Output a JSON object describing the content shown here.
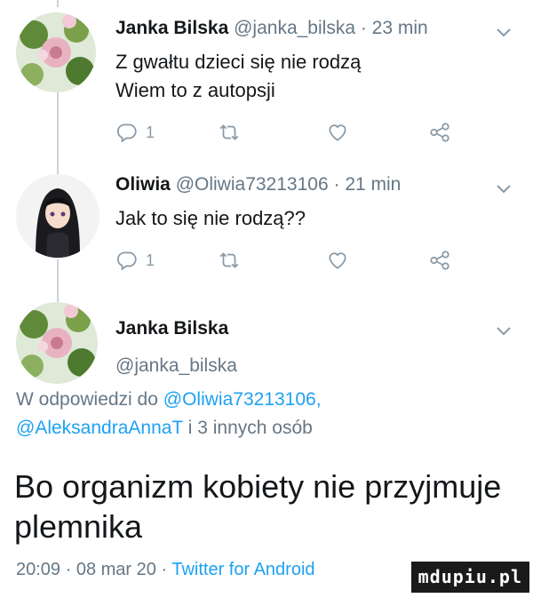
{
  "tweet1": {
    "name": "Janka Bilska",
    "handle": "@janka_bilska",
    "time": "23 min",
    "lines": [
      "Z gwałtu dzieci się nie rodzą",
      "Wiem to z autopsji"
    ],
    "reply_count": "1"
  },
  "tweet2": {
    "name": "Oliwia",
    "handle": "@Oliwia73213106",
    "time": "21 min",
    "lines": [
      "Jak to się nie rodzą??"
    ],
    "reply_count": "1"
  },
  "main": {
    "name": "Janka Bilska",
    "handle": "@janka_bilska",
    "reply_prefix": "W odpowiedzi do ",
    "reply_user1": "@Oliwia73213106,",
    "reply_user2": "@AleksandraAnnaT",
    "reply_suffix": " i 3 innych osób",
    "text_line1": "Bo organizm kobiety nie przyjmuje",
    "text_line2": "plemnika",
    "meta_time": "20:09",
    "meta_date": "08 mar 20",
    "meta_client": "Twitter for Android",
    "separator": " · "
  },
  "watermark": "mdupiu.pl",
  "icons": {
    "reply": "reply-icon",
    "retweet": "retweet-icon",
    "like": "heart-icon",
    "share": "share-icon",
    "more": "chevron-down-icon"
  },
  "colors": {
    "text": "#14171a",
    "secondary": "#657786",
    "link": "#1da1f2",
    "icon": "#8899a6",
    "thread_line": "#c9d4dd"
  }
}
